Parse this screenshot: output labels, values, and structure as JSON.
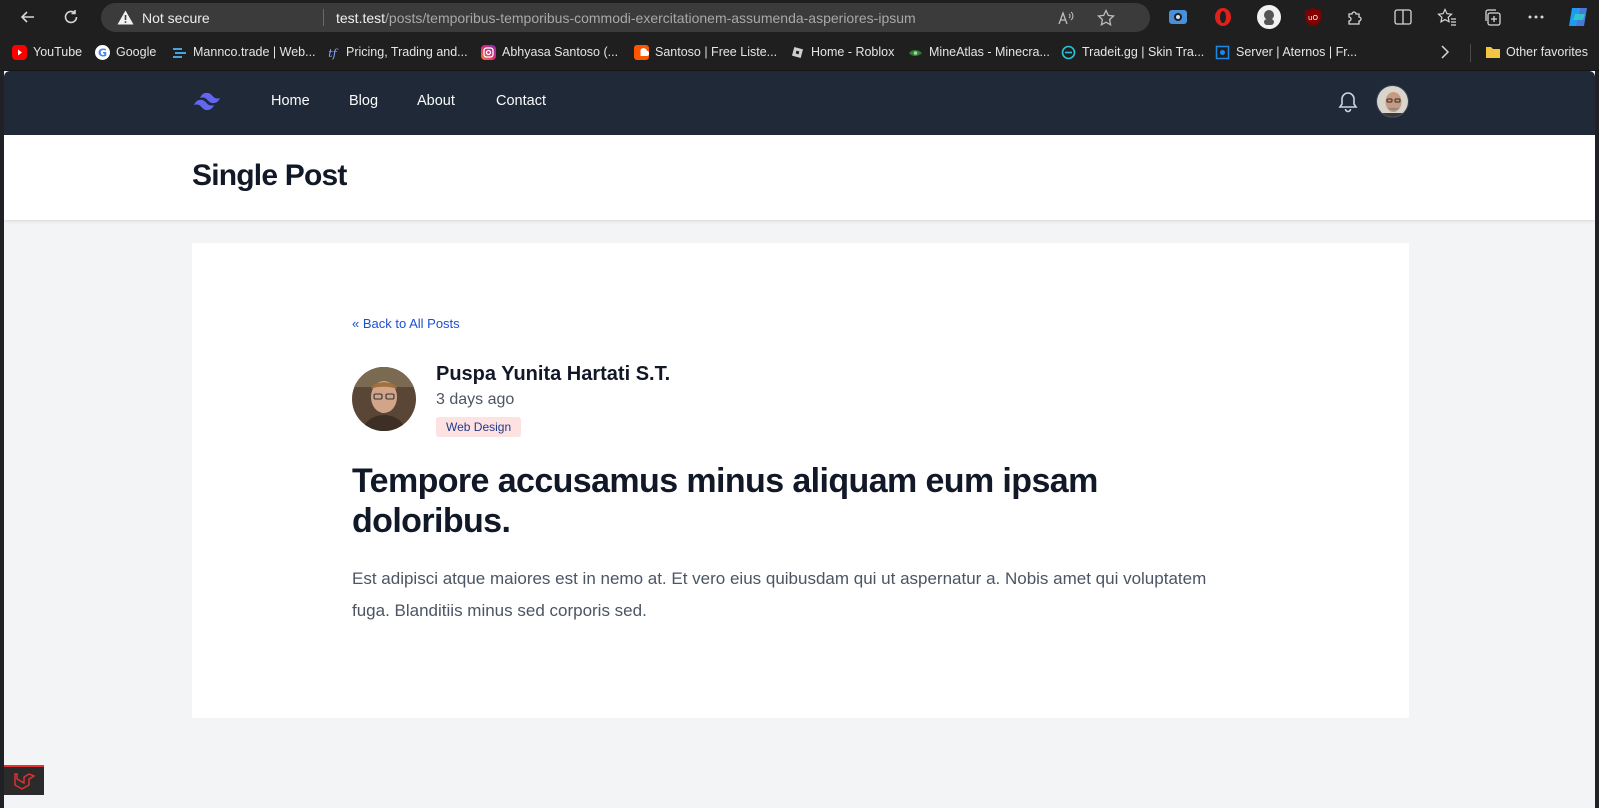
{
  "browser": {
    "address": {
      "security_label": "Not secure",
      "url_host": "test.test",
      "url_path": "/posts/temporibus-temporibus-commodi-exercitationem-assumenda-asperiores-ipsum"
    },
    "bookmarks": [
      {
        "label": "YouTube",
        "color": "#ff0000"
      },
      {
        "label": "Google",
        "color": "#ffffff"
      },
      {
        "label": "Mannco.trade | Web...",
        "color": "#4aa3df"
      },
      {
        "label": "Pricing, Trading and...",
        "color": "#5c7cfa"
      },
      {
        "label": "Abhyasa Santoso (...",
        "color": "#d6249f"
      },
      {
        "label": "Santoso | Free Liste...",
        "color": "#ff5500"
      },
      {
        "label": "Home - Roblox",
        "color": "#cfcfcf"
      },
      {
        "label": "MineAtlas - Minecra...",
        "color": "#2e7d32"
      },
      {
        "label": "Tradeit.gg | Skin Tra...",
        "color": "#26c6da"
      },
      {
        "label": "Server | Aternos | Fr...",
        "color": "#1e88e5"
      }
    ],
    "other_favorites": "Other favorites"
  },
  "site": {
    "nav": {
      "links": [
        "Home",
        "Blog",
        "About",
        "Contact"
      ]
    },
    "header": {
      "title": "Single Post"
    }
  },
  "post": {
    "back_link": "« Back to All Posts",
    "author": "Puspa Yunita Hartati S.T.",
    "time": "3 days ago",
    "category": "Web Design",
    "title": "Tempore accusamus minus aliquam eum ipsam doloribus.",
    "body": "Est adipisci atque maiores est in nemo at. Et vero eius quibusdam qui ut aspernatur a. Nobis amet qui voluptatem fuga. Blanditiis minus sed corporis sed."
  },
  "colors": {
    "nav_bg": "#1f2937",
    "page_bg": "#f3f4f6",
    "link": "#1d4ed8",
    "badge_bg": "#fee2e2",
    "logo": "#6366f1"
  }
}
